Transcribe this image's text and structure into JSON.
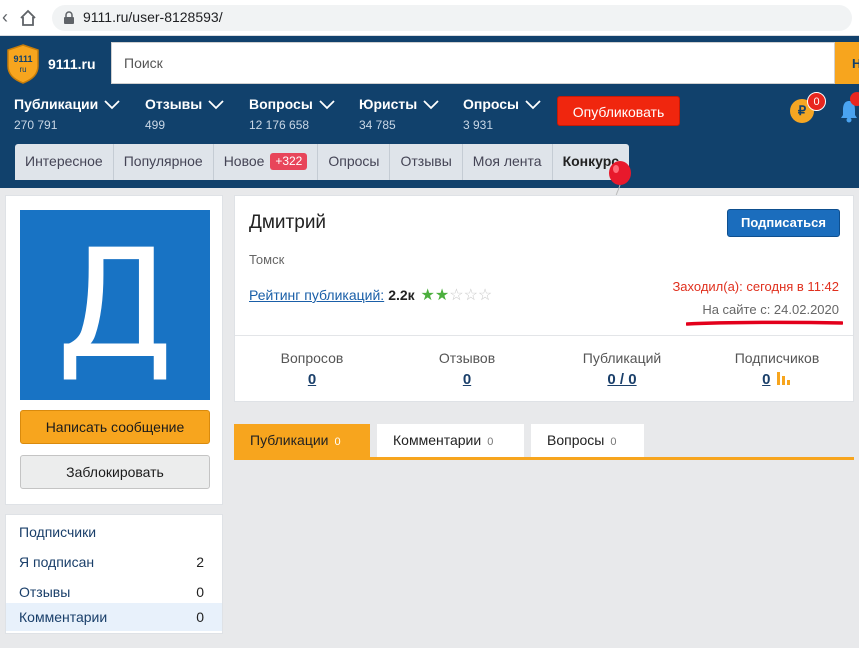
{
  "browser": {
    "url": "9111.ru/user-8128593/"
  },
  "site": {
    "logo_text": "9111.ru",
    "search_placeholder": "Поиск",
    "search_button": "Н",
    "nav": [
      {
        "label": "Публикации",
        "count": "270 791"
      },
      {
        "label": "Отзывы",
        "count": "499"
      },
      {
        "label": "Вопросы",
        "count": "12 176 658"
      },
      {
        "label": "Юристы",
        "count": "34 785"
      },
      {
        "label": "Опросы",
        "count": "3 931"
      }
    ],
    "publish_button": "Опубликовать",
    "coin_symbol": "₽",
    "coin_badge": "0",
    "tabs": {
      "interesting": "Интересное",
      "popular": "Популярное",
      "new": "Новое",
      "new_badge": "+322",
      "polls": "Опросы",
      "reviews": "Отзывы",
      "feed": "Моя лента",
      "contest": "Конкурс"
    }
  },
  "sidebar": {
    "avatar_letter": "Д",
    "write_message": "Написать сообщение",
    "block": "Заблокировать",
    "menu": [
      {
        "label": "Подписчики",
        "value": ""
      },
      {
        "label": "Я подписан",
        "value": "2"
      },
      {
        "label": "Отзывы",
        "value": "0"
      },
      {
        "label": "Комментарии",
        "value": "0"
      }
    ]
  },
  "profile": {
    "name": "Дмитрий",
    "city": "Томск",
    "rating_label": "Рейтинг публикаций:",
    "rating_value": "2.2к",
    "stars_filled": 2,
    "stars_total": 5,
    "subscribe": "Подписаться",
    "last_visit": "Заходил(а): сегодня в 11:42",
    "member_since": "На сайте с: 24.02.2020",
    "stats": [
      {
        "label": "Вопросов",
        "value": "0"
      },
      {
        "label": "Отзывов",
        "value": "0"
      },
      {
        "label": "Публикаций",
        "value": "0 / 0"
      },
      {
        "label": "Подписчиков",
        "value": "0"
      }
    ]
  },
  "content_tabs": [
    {
      "label": "Публикации",
      "count": "0"
    },
    {
      "label": "Комментарии",
      "count": "0"
    },
    {
      "label": "Вопросы",
      "count": "0"
    }
  ],
  "colors": {
    "header_bg": "#11416c",
    "accent_orange": "#f7a51e",
    "publish_red": "#f0260e",
    "avatar_blue": "#1873c4",
    "annotation_red": "#e3001b"
  }
}
